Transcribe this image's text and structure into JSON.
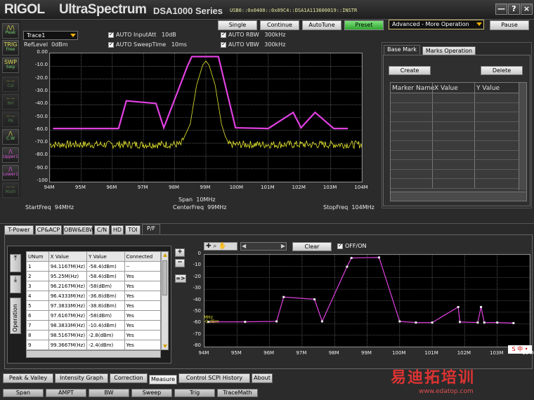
{
  "title_bar": {
    "brand": "RIGOL",
    "product": "UltraSpectrum",
    "series": "DSA1000 Series",
    "device": "USB0::0x0400::0x09C4::DSA1A113600019::INSTR",
    "minimize": "—",
    "help": "?",
    "close": "×"
  },
  "mode_buttons": [
    {
      "label": "Peak",
      "glyph": "/\\/\\"
    },
    {
      "label": "Free",
      "glyph": "TRIG"
    },
    {
      "label": "Swp",
      "glyph": "SWP"
    },
    {
      "label": "Cal",
      "glyph": "~~"
    },
    {
      "label": "NH",
      "glyph": "~~"
    },
    {
      "label": "PA",
      "glyph": "~~"
    },
    {
      "label": "C.W",
      "glyph": "/\\"
    },
    {
      "label": "Upper1",
      "glyph": "/\\"
    },
    {
      "label": "Lower1",
      "glyph": "/\\"
    },
    {
      "label": "Math",
      "glyph": "~~"
    }
  ],
  "controls": {
    "trace_select": "Trace1",
    "ref_level_label": "RefLevel",
    "ref_level_value": "0dBm",
    "auto_input_att": "AUTO InputAtt",
    "input_att_value": "10dB",
    "auto_sweep_time": "AUTO SweepTime",
    "sweep_time_value": "10ms",
    "auto_rbw": "AUTO RBW",
    "rbw_value": "300kHz",
    "auto_vbw": "AUTO VBW",
    "vbw_value": "300kHz",
    "single": "Single",
    "continue": "Continue",
    "autotune": "AutoTune",
    "preset": "Preset",
    "operation_select": "Advanced - More Operation",
    "pause": "Pause"
  },
  "main_plot": {
    "yticks": [
      "0.00",
      "-10.0",
      "-20.0",
      "-30.0",
      "-40.0",
      "-50.0",
      "-60.0",
      "-70.0",
      "-80.0",
      "-90.0",
      "-100"
    ],
    "xticks": [
      "94M",
      "95M",
      "96M",
      "97M",
      "98M",
      "99M",
      "100M",
      "101M",
      "102M",
      "103M",
      "104M"
    ],
    "start_freq_label": "StartFreq",
    "start_freq_value": "94MHz",
    "span_label": "Span",
    "span_value": "10MHz",
    "center_freq_label": "CenterFreq",
    "center_freq_value": "99MHz",
    "stop_freq_label": "StopFreq",
    "stop_freq_value": "104MHz",
    "mask_color": "#e040e0",
    "trace_color": "#e8e830"
  },
  "marker_panel": {
    "tabs": [
      "Base Mark",
      "Marks Operation"
    ],
    "create": "Create",
    "delete": "Delete",
    "columns": [
      "Marker Name",
      "X Value",
      "Y Value"
    ]
  },
  "measure_tabs": [
    "T-Power",
    "CP&ACP",
    "OBW&EBW",
    "C/N",
    "HD",
    "TOI",
    "P/F"
  ],
  "pf_table": {
    "columns": [
      "UNum",
      "X Value",
      "Y Value",
      "Connected"
    ],
    "rows": [
      [
        "1",
        "94.1167M(Hz)",
        "-58.4(dBm)",
        "--"
      ],
      [
        "2",
        "95.25M(Hz)",
        "-58.4(dBm)",
        "Yes"
      ],
      [
        "3",
        "96.2167M(Hz)",
        "-58(dBm)",
        "Yes"
      ],
      [
        "4",
        "96.4333M(Hz)",
        "-36.8(dBm)",
        "Yes"
      ],
      [
        "5",
        "97.3833M(Hz)",
        "-38.8(dBm)",
        "Yes"
      ],
      [
        "6",
        "97.6167M(Hz)",
        "-58(dBm)",
        "Yes"
      ],
      [
        "7",
        "98.3833M(Hz)",
        "-10.4(dBm)",
        "Yes"
      ],
      [
        "8",
        "98.5167M(Hz)",
        "-2.8(dBm)",
        "Yes"
      ],
      [
        "9",
        "99.3667M(Hz)",
        "-2.4(dBm)",
        "Yes"
      ]
    ],
    "operation_label": "Operation",
    "add": "+",
    "remove": "−",
    "apply": "=>"
  },
  "pf_plot_controls": {
    "clear": "Clear",
    "off_on": "OFF/ON",
    "marker_label": "MHz\n-0 dBm"
  },
  "pf_plot": {
    "yticks": [
      "0",
      "-10",
      "-20",
      "-30",
      "-40",
      "-50",
      "-60",
      "-70",
      "-80"
    ],
    "xticks": [
      "94M",
      "95M",
      "96M",
      "97M",
      "98M",
      "99M",
      "100M",
      "101M",
      "102M",
      "103M",
      "104M"
    ]
  },
  "bottom_tabs": [
    "Peak & Valley",
    "Intensity Graph",
    "Correction",
    "Measure",
    "Control SCPI History",
    "About"
  ],
  "softkeys": [
    "Span",
    "AMPT",
    "BW",
    "Sweep",
    "Trig",
    "TraceMath"
  ],
  "watermark": {
    "text": "易迪拓培训",
    "url": "www.edatop.com"
  },
  "chart_data": [
    {
      "type": "line",
      "xlim": [
        94,
        104
      ],
      "ylim": [
        -100,
        0
      ],
      "series": [
        {
          "values": [
            [
              94.1,
              -58.5
            ],
            [
              96.2,
              -58.5
            ],
            [
              96.45,
              -37
            ],
            [
              97.4,
              -39
            ],
            [
              97.65,
              -58
            ],
            [
              98.4,
              -10.5
            ],
            [
              98.55,
              -2.5
            ],
            [
              99.4,
              -2.5
            ],
            [
              99.95,
              -58
            ],
            [
              101.0,
              -58.5
            ],
            [
              101.8,
              -46
            ],
            [
              102.05,
              -58
            ],
            [
              102.5,
              -46
            ],
            [
              103.1,
              -58.5
            ],
            [
              103.55,
              -58.5
            ]
          ]
        },
        {
          "values": [
            [
              94,
              -71
            ],
            [
              98.2,
              -71
            ],
            [
              98.5,
              -55
            ],
            [
              98.7,
              -25
            ],
            [
              98.9,
              -9
            ],
            [
              99.0,
              -6
            ],
            [
              99.1,
              -9
            ],
            [
              99.3,
              -25
            ],
            [
              99.5,
              -55
            ],
            [
              99.7,
              -71
            ],
            [
              104,
              -71
            ]
          ]
        }
      ]
    },
    {
      "type": "line",
      "xlim": [
        94,
        104
      ],
      "ylim": [
        -80,
        0
      ],
      "series": [
        {
          "values": [
            [
              94.1167,
              -58.4
            ],
            [
              95.25,
              -58.4
            ],
            [
              96.2167,
              -58
            ],
            [
              96.4333,
              -36.8
            ],
            [
              97.3833,
              -38.8
            ],
            [
              97.6167,
              -58
            ],
            [
              98.3833,
              -10.4
            ],
            [
              98.5167,
              -2.8
            ],
            [
              99.3667,
              -2.4
            ],
            [
              100.0,
              -58
            ],
            [
              100.5,
              -59
            ],
            [
              101.0,
              -59
            ],
            [
              101.8,
              -45.5
            ],
            [
              101.85,
              -58.5
            ],
            [
              102.4,
              -59
            ],
            [
              102.5,
              -45.5
            ],
            [
              102.6,
              -59
            ],
            [
              103.0,
              -59
            ],
            [
              103.5,
              -59.5
            ]
          ]
        }
      ]
    }
  ]
}
